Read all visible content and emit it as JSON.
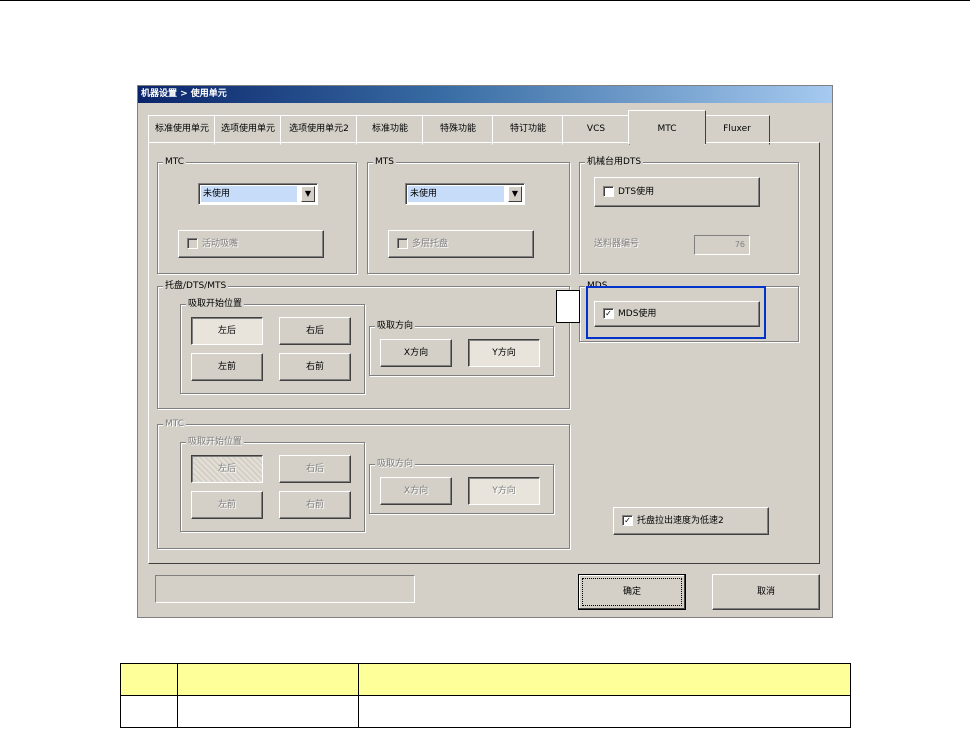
{
  "dialog": {
    "title": "机器设置 > 使用单元",
    "tabs": [
      "标准使用单元",
      "选项使用单元",
      "选项使用单元2",
      "标准功能",
      "特殊功能",
      "特订功能",
      "VCS",
      "MTC",
      "Fluxer"
    ],
    "active_tab": "MTC"
  },
  "mtc_group": {
    "title": "MTC",
    "select_value": "未使用",
    "checkbox_label": "活动吸嘴",
    "checked": false,
    "enabled": false
  },
  "mts_group": {
    "title": "MTS",
    "select_value": "未使用",
    "checkbox_label": "多层托盘",
    "checked": false,
    "enabled": false
  },
  "dts_group": {
    "title": "机械台用DTS",
    "checkbox_label": "DTS使用",
    "checked": false,
    "feeder_label": "送料器编号",
    "feeder_value": "76"
  },
  "mds_group": {
    "title": "MDS",
    "checkbox_label": "MDS使用",
    "checked": true
  },
  "tray_group": {
    "title": "托盘/DTS/MTS",
    "pickup_pos_title": "吸取开始位置",
    "pos_buttons": [
      "左后",
      "右后",
      "左前",
      "右前"
    ],
    "selected_pos": "左后",
    "dir_title": "吸取方向",
    "dir_buttons": [
      "X方向",
      "Y方向"
    ],
    "selected_dir": "Y方向"
  },
  "mtc_group2": {
    "title": "MTC",
    "pickup_pos_title": "吸取开始位置",
    "pos_buttons": [
      "左后",
      "右后",
      "左前",
      "右前"
    ],
    "selected_pos": "左后",
    "dir_title": "吸取方向",
    "dir_buttons": [
      "X方向",
      "Y方向"
    ],
    "selected_dir": "Y方向",
    "enabled": false
  },
  "low_speed": {
    "checkbox_label": "托盘拉出速度为低速2",
    "checked": true
  },
  "footer": {
    "ok_label": "确定",
    "cancel_label": "取消"
  },
  "legend_table": {
    "rows": [
      [
        "",
        "",
        ""
      ],
      [
        "",
        "",
        ""
      ]
    ]
  },
  "colors": {
    "highlight_box": "#0033cc",
    "table_header": "#ffff99",
    "dialog_bg": "#d4d0c8"
  }
}
